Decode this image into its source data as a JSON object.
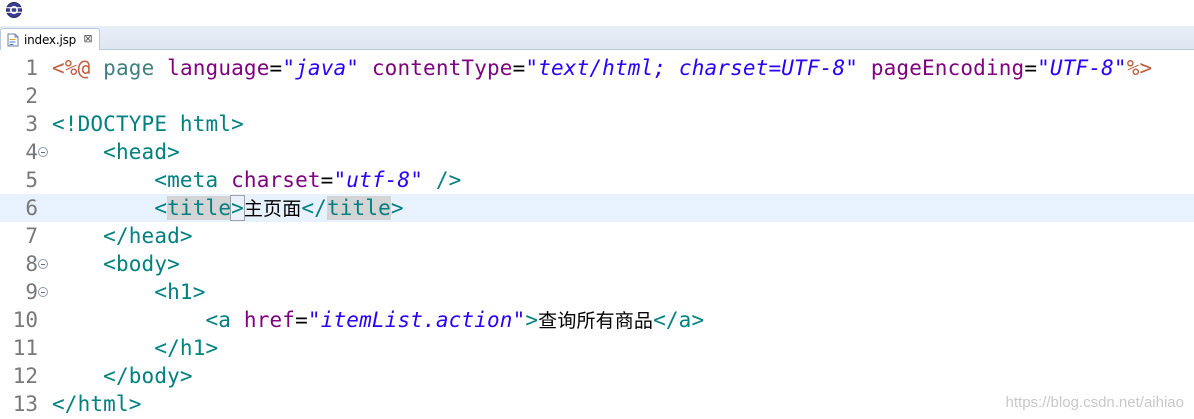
{
  "tab": {
    "file_name": "index.jsp",
    "close_symbol": "⊠"
  },
  "colors": {
    "jsp_delim": "#bf5f3f",
    "attr": "#7f007f",
    "string": "#2a00ff",
    "tag": "#008080",
    "current_line": "#e8f2fe"
  },
  "lines": [
    {
      "num": "1",
      "tokens": [
        {
          "t": "<%@",
          "c": "jsp"
        },
        {
          "t": " page ",
          "c": "dir"
        },
        {
          "t": "language",
          "c": "attr"
        },
        {
          "t": "=",
          "c": "eq"
        },
        {
          "t": "\"java\"",
          "c": "str"
        },
        {
          "t": " contentType",
          "c": "attr"
        },
        {
          "t": "=",
          "c": "eq"
        },
        {
          "t": "\"text/html; charset=UTF-8\"",
          "c": "str"
        },
        {
          "t": " pageEncoding",
          "c": "attr"
        },
        {
          "t": "=",
          "c": "eq"
        },
        {
          "t": "\"UTF-8\"",
          "c": "str"
        },
        {
          "t": "%>",
          "c": "jsp"
        }
      ]
    },
    {
      "num": "2",
      "tokens": []
    },
    {
      "num": "3",
      "tokens": [
        {
          "t": "<!DOCTYPE html>",
          "c": "doctype"
        }
      ]
    },
    {
      "num": "4",
      "fold": true,
      "tokens": [
        {
          "t": "    <head>",
          "c": "tag"
        }
      ]
    },
    {
      "num": "5",
      "tokens": [
        {
          "t": "        <meta ",
          "c": "tag"
        },
        {
          "t": "charset",
          "c": "attr"
        },
        {
          "t": "=",
          "c": "eq"
        },
        {
          "t": "\"utf-8\"",
          "c": "str"
        },
        {
          "t": " />",
          "c": "tag"
        }
      ]
    },
    {
      "num": "6",
      "current": true,
      "tokens": [
        {
          "t": "        <",
          "c": "tag"
        },
        {
          "t": "title",
          "c": "tag hl"
        },
        {
          "t": ">",
          "c": "tag box"
        },
        {
          "t": "主页面",
          "c": "text"
        },
        {
          "t": "</",
          "c": "tag"
        },
        {
          "t": "title",
          "c": "tag hl"
        },
        {
          "t": ">",
          "c": "tag"
        }
      ]
    },
    {
      "num": "7",
      "tokens": [
        {
          "t": "    </head>",
          "c": "tag"
        }
      ]
    },
    {
      "num": "8",
      "fold": true,
      "tokens": [
        {
          "t": "    <body>",
          "c": "tag"
        }
      ]
    },
    {
      "num": "9",
      "fold": true,
      "tokens": [
        {
          "t": "        <h1>",
          "c": "tag"
        }
      ]
    },
    {
      "num": "10",
      "tokens": [
        {
          "t": "            <a ",
          "c": "tag"
        },
        {
          "t": "href",
          "c": "attr"
        },
        {
          "t": "=",
          "c": "eq"
        },
        {
          "t": "\"itemList.action\"",
          "c": "str"
        },
        {
          "t": ">",
          "c": "tag"
        },
        {
          "t": "查询所有商品",
          "c": "text"
        },
        {
          "t": "</a>",
          "c": "tag"
        }
      ]
    },
    {
      "num": "11",
      "tokens": [
        {
          "t": "        </h1>",
          "c": "tag"
        }
      ]
    },
    {
      "num": "12",
      "tokens": [
        {
          "t": "    </body>",
          "c": "tag"
        }
      ]
    },
    {
      "num": "13",
      "tokens": [
        {
          "t": "</html>",
          "c": "tag"
        }
      ]
    }
  ],
  "watermark": "https://blog.csdn.net/aihiao"
}
